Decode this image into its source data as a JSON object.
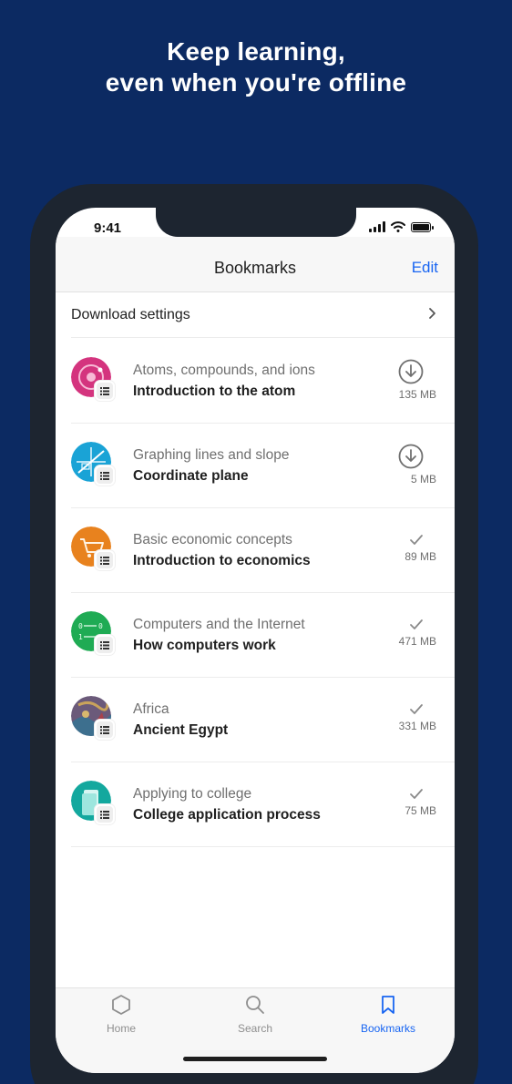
{
  "headline": {
    "line1": "Keep learning,",
    "line2": "even when you're offline"
  },
  "status_bar": {
    "time": "9:41"
  },
  "nav": {
    "title": "Bookmarks",
    "edit_label": "Edit"
  },
  "settings": {
    "label": "Download settings"
  },
  "bookmarks": [
    {
      "subtitle": "Atoms, compounds, and ions",
      "title": "Introduction to the atom",
      "size": "135 MB",
      "status": "download",
      "color": "#d4347e"
    },
    {
      "subtitle": "Graphing lines and slope",
      "title": "Coordinate plane",
      "size": "5 MB",
      "status": "download",
      "color": "#1aa3d6"
    },
    {
      "subtitle": "Basic economic concepts",
      "title": "Introduction to economics",
      "size": "89 MB",
      "status": "downloaded",
      "color": "#e8821e"
    },
    {
      "subtitle": "Computers and the Internet",
      "title": "How computers work",
      "size": "471 MB",
      "status": "downloaded",
      "color": "#1fab54"
    },
    {
      "subtitle": "Africa",
      "title": "Ancient Egypt",
      "size": "331 MB",
      "status": "downloaded",
      "color": "#6b5a7a"
    },
    {
      "subtitle": "Applying to college",
      "title": "College application process",
      "size": "75 MB",
      "status": "downloaded",
      "color": "#13a89e"
    }
  ],
  "tabs": [
    {
      "label": "Home",
      "icon": "hexagon-icon"
    },
    {
      "label": "Search",
      "icon": "search-icon"
    },
    {
      "label": "Bookmarks",
      "icon": "bookmark-icon",
      "active": true
    }
  ],
  "colors": {
    "background": "#0c2a62",
    "accent": "#1865f2"
  }
}
